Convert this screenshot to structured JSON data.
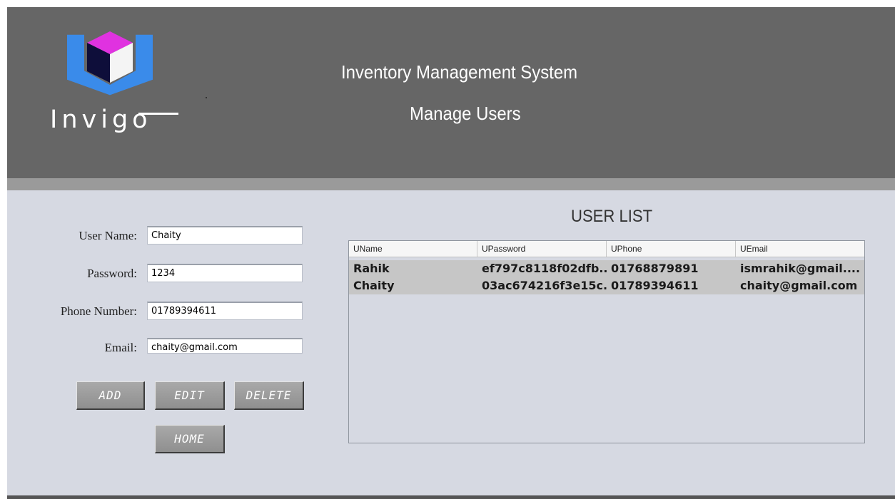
{
  "header": {
    "logo_text": "Invigo",
    "app_title": "Inventory Management System",
    "page_title": "Manage Users",
    "colors": {
      "header_bg": "#666666",
      "content_bg": "#d6d9e2",
      "logo_top": "#e032e0",
      "logo_left": "#0e0e3a",
      "logo_right": "#f4f4f4",
      "logo_frame": "#3a8bea"
    }
  },
  "form": {
    "labels": {
      "user_name": "User Name:",
      "password": "Password:",
      "phone": "Phone Number:",
      "email": "Email:"
    },
    "values": {
      "user_name": "Chaity",
      "password": "1234",
      "phone": "01789394611",
      "email": "chaity@gmail.com"
    }
  },
  "buttons": {
    "add": "ADD",
    "edit": "EDIT",
    "delete": "DELETE",
    "home": "HOME"
  },
  "user_list": {
    "title": "USER LIST",
    "columns": [
      "UName",
      "UPassword",
      "UPhone",
      "UEmail"
    ],
    "rows": [
      [
        "Rahik",
        "ef797c8118f02dfb...",
        "01768879891",
        "ismrahik@gmail...."
      ],
      [
        "Chaity",
        "03ac674216f3e15c...",
        "01789394611",
        "chaity@gmail.com"
      ]
    ]
  }
}
